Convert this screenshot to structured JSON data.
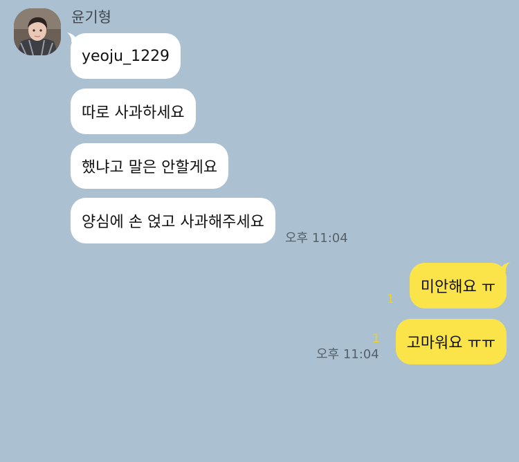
{
  "chat": {
    "sender_name": "윤기형",
    "incoming": [
      {
        "text": "yeoju_1229"
      },
      {
        "text": "따로 사과하세요"
      },
      {
        "text": "했냐고 말은 안할게요"
      },
      {
        "text": "양심에 손 얹고 사과해주세요"
      }
    ],
    "incoming_time": "오후 11:04",
    "outgoing": [
      {
        "text": "미안해요 ㅠ",
        "unread": "1"
      },
      {
        "text": "고마워요 ㅠㅠ",
        "unread": "1"
      }
    ],
    "outgoing_time": "오후 11:04"
  },
  "colors": {
    "background": "#abc1d1",
    "incoming_bubble": "#ffffff",
    "outgoing_bubble": "#fae44a",
    "unread_count": "#f0d21c"
  },
  "icons": {
    "avatar": "profile-photo"
  }
}
